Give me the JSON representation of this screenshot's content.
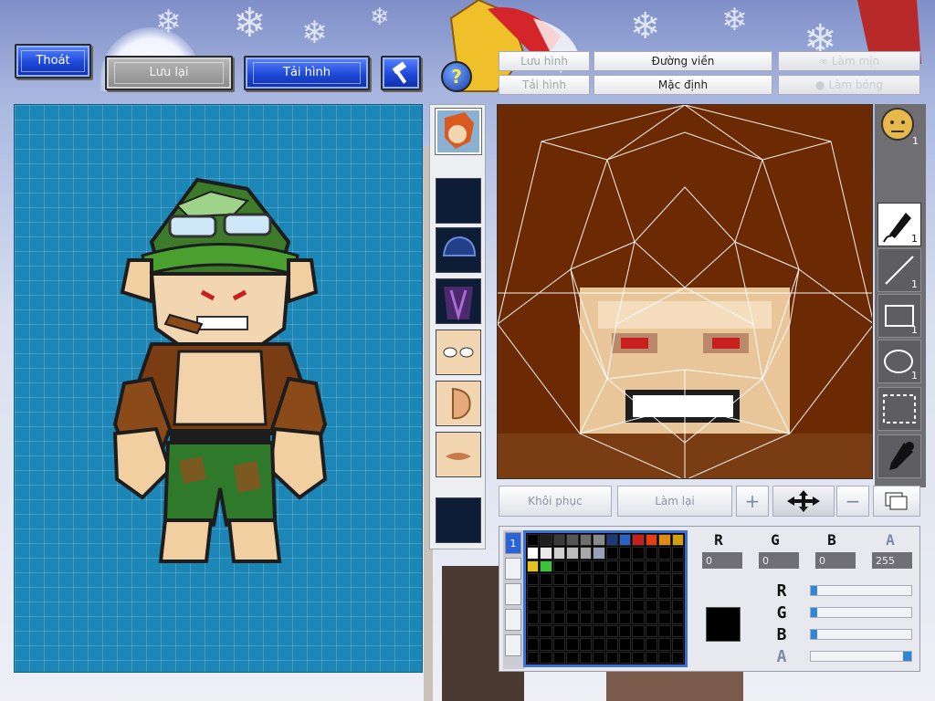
{
  "toolbar": {
    "exit": "Thoát",
    "save": "Lưu lại",
    "reload": "Tải hình"
  },
  "editor_buttons": {
    "save_image": "Lưu hình",
    "outline": "Đường viền",
    "reload_image": "Tải hình",
    "default": "Mặc định",
    "smooth": "Làm mịn",
    "shade": "Làm bóng"
  },
  "bottom_buttons": {
    "restore": "Khôi phục",
    "redo": "Làm lại"
  },
  "tools": {
    "face_count": "1",
    "brush_count": "1",
    "line_count": "1",
    "rect_count": "1",
    "ellipse_count": "1"
  },
  "layers": {
    "active": "1"
  },
  "color": {
    "labels": [
      "R",
      "G",
      "B",
      "A"
    ],
    "values": [
      "0",
      "0",
      "0",
      "255"
    ],
    "current": "#000000",
    "slider_levels": {
      "R": 0,
      "G": 0,
      "B": 0,
      "A": 1
    }
  },
  "palette": [
    "#000000",
    "#1f1f1f",
    "#3a3a3a",
    "#555555",
    "#6f6f6f",
    "#8a8a8a",
    "#1e3a78",
    "#2a62c8",
    "#c81e1e",
    "#e83c14",
    "#e08a14",
    "#d0a010",
    "#ffffff",
    "#e9e9e9",
    "#d0d0d0",
    "#bcbcbc",
    "#a8a8a8",
    "#96a2b8",
    "#000000",
    "#000000",
    "#000000",
    "#000000",
    "#000000",
    "#000000",
    "#e8c020",
    "#3cc33c",
    "#000000"
  ]
}
